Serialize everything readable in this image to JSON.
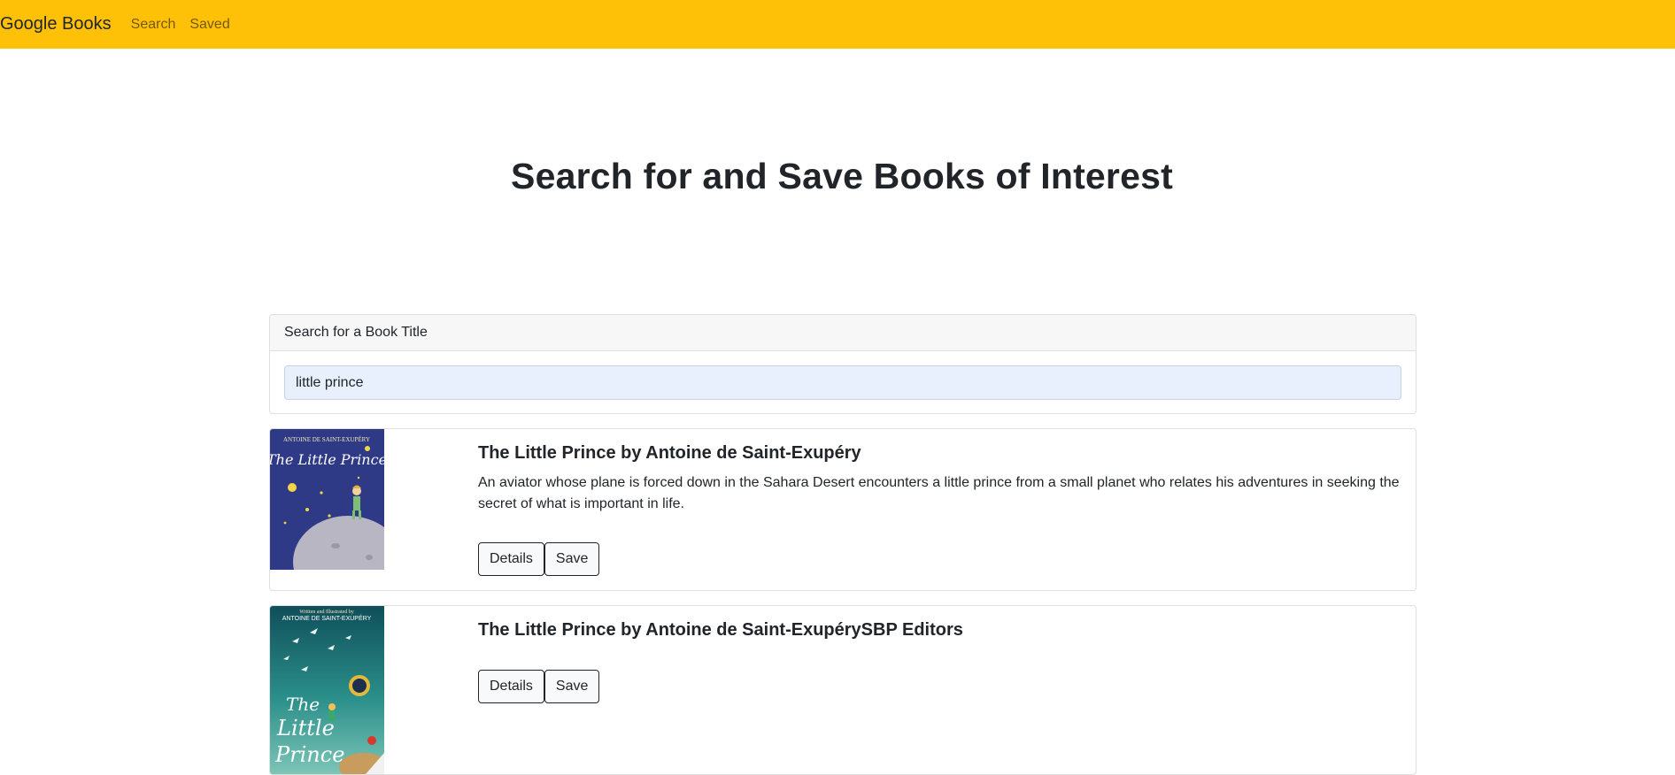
{
  "navbar": {
    "brand": "Google Books",
    "links": [
      "Search",
      "Saved"
    ],
    "bg_color": "#FFC107"
  },
  "hero": {
    "title": "Search for and Save Books of Interest"
  },
  "search": {
    "header": "Search for a Book Title",
    "value": "little prince"
  },
  "results": [
    {
      "title": "The Little Prince by Antoine de Saint-Exupéry",
      "description": "An aviator whose plane is forced down in the Sahara Desert encounters a little prince from a small planet who relates his adventures in seeking the secret of what is important in life.",
      "details_label": "Details",
      "save_label": "Save",
      "cover_author": "ANTOINE DE SAINT-EXUPÉRY",
      "cover_title": "The Little Prince"
    },
    {
      "title": "The Little Prince by Antoine de Saint-ExupérySBP Editors",
      "description": "",
      "details_label": "Details",
      "save_label": "Save",
      "cover_top": "Written and Illustrated by",
      "cover_author": "ANTOINE DE SAINT-EXUPÉRY",
      "cover_title_lines": [
        "The",
        "Little",
        "Prince"
      ]
    }
  ]
}
